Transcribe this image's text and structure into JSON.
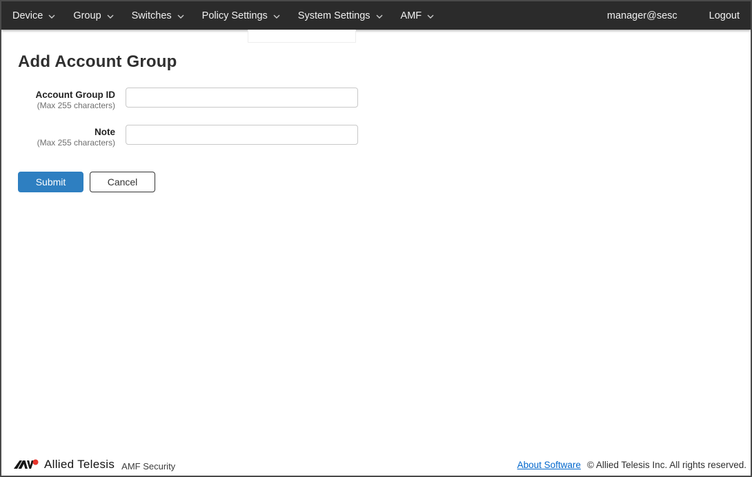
{
  "navbar": {
    "items": [
      {
        "label": "Device"
      },
      {
        "label": "Group"
      },
      {
        "label": "Switches"
      },
      {
        "label": "Policy Settings"
      },
      {
        "label": "System Settings"
      },
      {
        "label": "AMF"
      }
    ],
    "user": "manager@sesc",
    "logout_label": "Logout"
  },
  "page": {
    "title": "Add Account Group"
  },
  "form": {
    "fields": [
      {
        "label": "Account Group ID",
        "hint": "(Max 255 characters)",
        "value": ""
      },
      {
        "label": "Note",
        "hint": "(Max 255 characters)",
        "value": ""
      }
    ],
    "submit_label": "Submit",
    "cancel_label": "Cancel"
  },
  "footer": {
    "brand": "Allied Telesis",
    "product": "AMF Security",
    "about_link": "About Software",
    "copyright": "© Allied Telesis Inc. All rights reserved."
  },
  "colors": {
    "navbar_bg": "#2b2b2b",
    "accent_blue": "#2e7fc1",
    "link_blue": "#0066cc",
    "logo_red": "#e8342c"
  }
}
